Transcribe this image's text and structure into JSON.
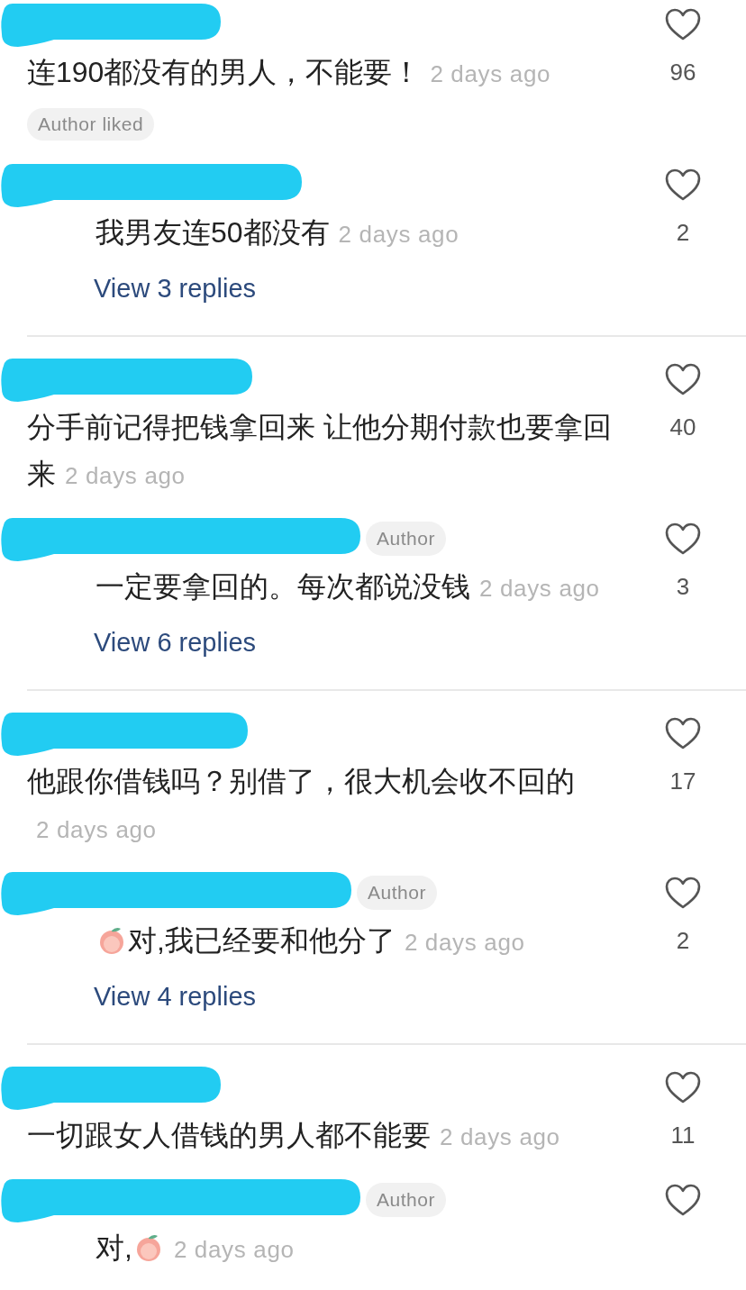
{
  "threads": [
    {
      "comment": {
        "parts": [
          {
            "kind": "text",
            "text": "连190都没有的男人，不能要！"
          }
        ],
        "time": "2 days ago",
        "likes": "96",
        "liked_badge": "Author liked"
      },
      "reply": {
        "parts": [
          {
            "kind": "text",
            "text": "我男友连50都没有"
          }
        ],
        "time": "2 days ago",
        "likes": "2"
      },
      "view_replies": "View 3 replies"
    },
    {
      "comment": {
        "parts": [
          {
            "kind": "line",
            "text": "分手前记得把钱拿回来 让他分期付款也要拿回"
          },
          {
            "kind": "text",
            "text": "来"
          }
        ],
        "time": "2 days ago",
        "likes": "40"
      },
      "reply": {
        "author_badge": "Author",
        "parts": [
          {
            "kind": "text",
            "text": "一定要拿回的。每次都说没钱"
          }
        ],
        "time": "2 days ago",
        "likes": "3"
      },
      "view_replies": "View 6 replies"
    },
    {
      "comment": {
        "parts": [
          {
            "kind": "text",
            "text": "他跟你借钱吗？别借了，很大机会收不回的"
          }
        ],
        "time": "2 days ago",
        "likes": "17"
      },
      "reply": {
        "author_badge": "Author",
        "parts": [
          {
            "kind": "emoji"
          },
          {
            "kind": "text",
            "text": "对,我已经要和他分了"
          }
        ],
        "time": "2 days ago",
        "likes": "2"
      },
      "view_replies": "View 4 replies"
    },
    {
      "comment": {
        "parts": [
          {
            "kind": "text",
            "text": "一切跟女人借钱的男人都不能要"
          }
        ],
        "time": "2 days ago",
        "likes": "11"
      },
      "reply": {
        "author_badge": "Author",
        "parts": [
          {
            "kind": "text",
            "text": "对,"
          },
          {
            "kind": "emoji"
          }
        ],
        "time": "2 days ago"
      }
    }
  ]
}
